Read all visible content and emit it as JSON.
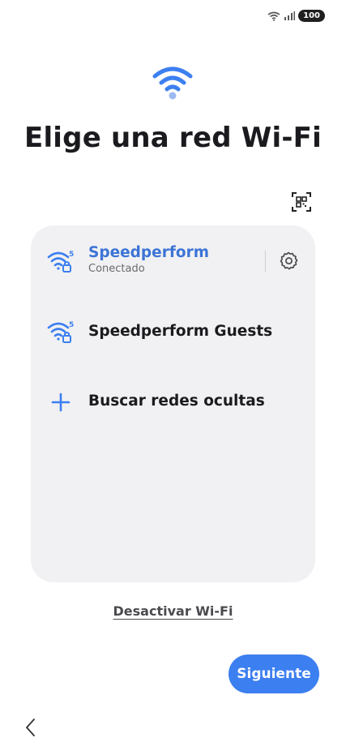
{
  "status_bar": {
    "battery": "100",
    "icons": [
      "wifi-icon",
      "signal-icon"
    ]
  },
  "header": {
    "hero_icon": "wifi-icon",
    "title": "Elige una red Wi-Fi",
    "qr_icon": "qr-code-icon"
  },
  "networks": [
    {
      "name": "Speedperform",
      "status": "Conectado",
      "icon": "wifi-5ghz-locked-icon",
      "connected": true,
      "settings_icon": "gear-icon"
    },
    {
      "name": "Speedperform Guests",
      "icon": "wifi-5ghz-locked-icon",
      "connected": false
    }
  ],
  "hidden_networks": {
    "label": "Buscar redes ocultas",
    "icon": "plus-icon"
  },
  "footer": {
    "disable_wifi": "Desactivar Wi-Fi",
    "next": "Siguiente",
    "back_icon": "chevron-left-icon"
  },
  "colors": {
    "accent": "#3c7ff0",
    "connected_text": "#3c74d6",
    "card_bg": "#f1f1f3"
  }
}
